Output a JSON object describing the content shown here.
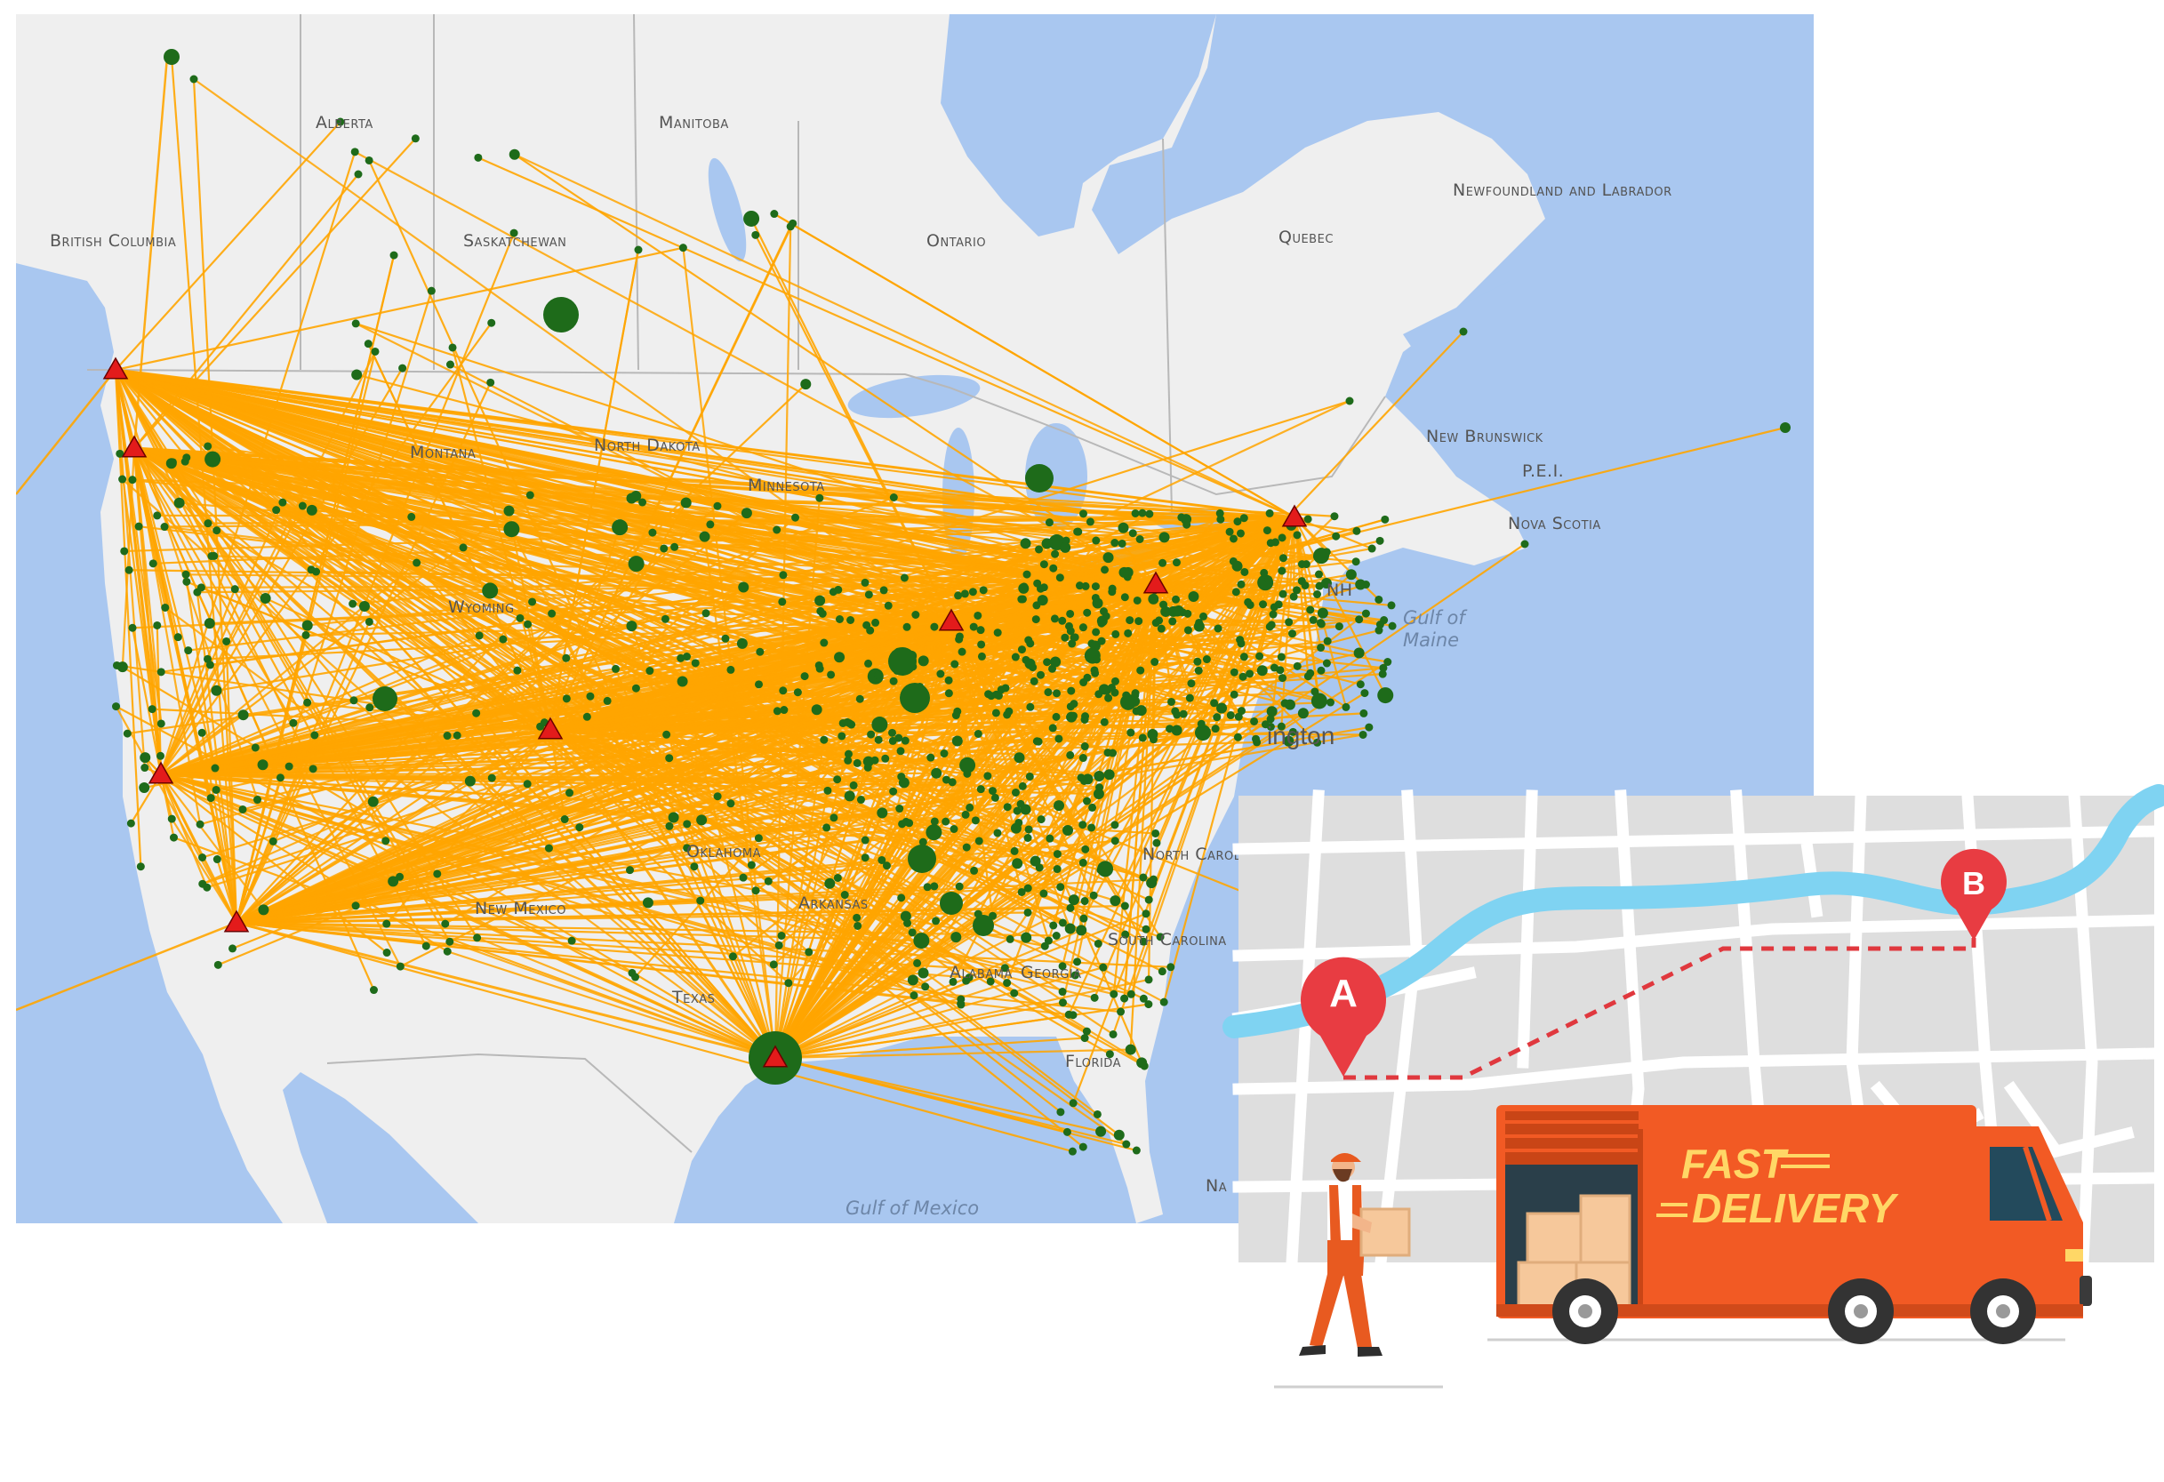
{
  "map": {
    "region_labels": {
      "alberta": "Alberta",
      "manitoba": "Manitoba",
      "british_columbia": "British Columbia",
      "saskatchewan": "Saskatchewan",
      "ontario": "Ontario",
      "quebec": "Quebec",
      "newfoundland": "Newfoundland and Labrador",
      "new_brunswick": "New Brunswick",
      "nova_scotia": "Nova Scotia",
      "pei": "P.E.I.",
      "montana": "Montana",
      "north_dakota": "North Dakota",
      "minnesota": "Minnesota",
      "wyoming": "Wyoming",
      "new_mexico": "New Mexico",
      "oklahoma": "Oklahoma",
      "arkansas": "Arkansas",
      "texas": "Texas",
      "alabama": "Alabama",
      "georgia": "Georgia",
      "south_carolina": "South Carolina",
      "north_carolina": "North Carolina",
      "florida": "Florida",
      "nh": "NH",
      "nassau": "Na"
    },
    "water_labels": {
      "gulf_of_maine_1": "Gulf of",
      "gulf_of_maine_2": "Maine",
      "gulf_of_mexico": "Gulf of Mexico"
    },
    "city_labels": {
      "washington": "ington"
    },
    "colors": {
      "ocean": "#a9c7f0",
      "land": "#efefef",
      "route": "#ffa500",
      "node": "#1e6b1a",
      "hub": "#e31b1b"
    }
  },
  "illustration": {
    "pin_a": "A",
    "pin_b": "B",
    "van_text_1": "FAST",
    "van_text_2": "DELIVERY",
    "colors": {
      "street_bg": "#dedede",
      "river": "#7fd3f2",
      "van": "#f25a24",
      "pin": "#e83c42"
    }
  }
}
